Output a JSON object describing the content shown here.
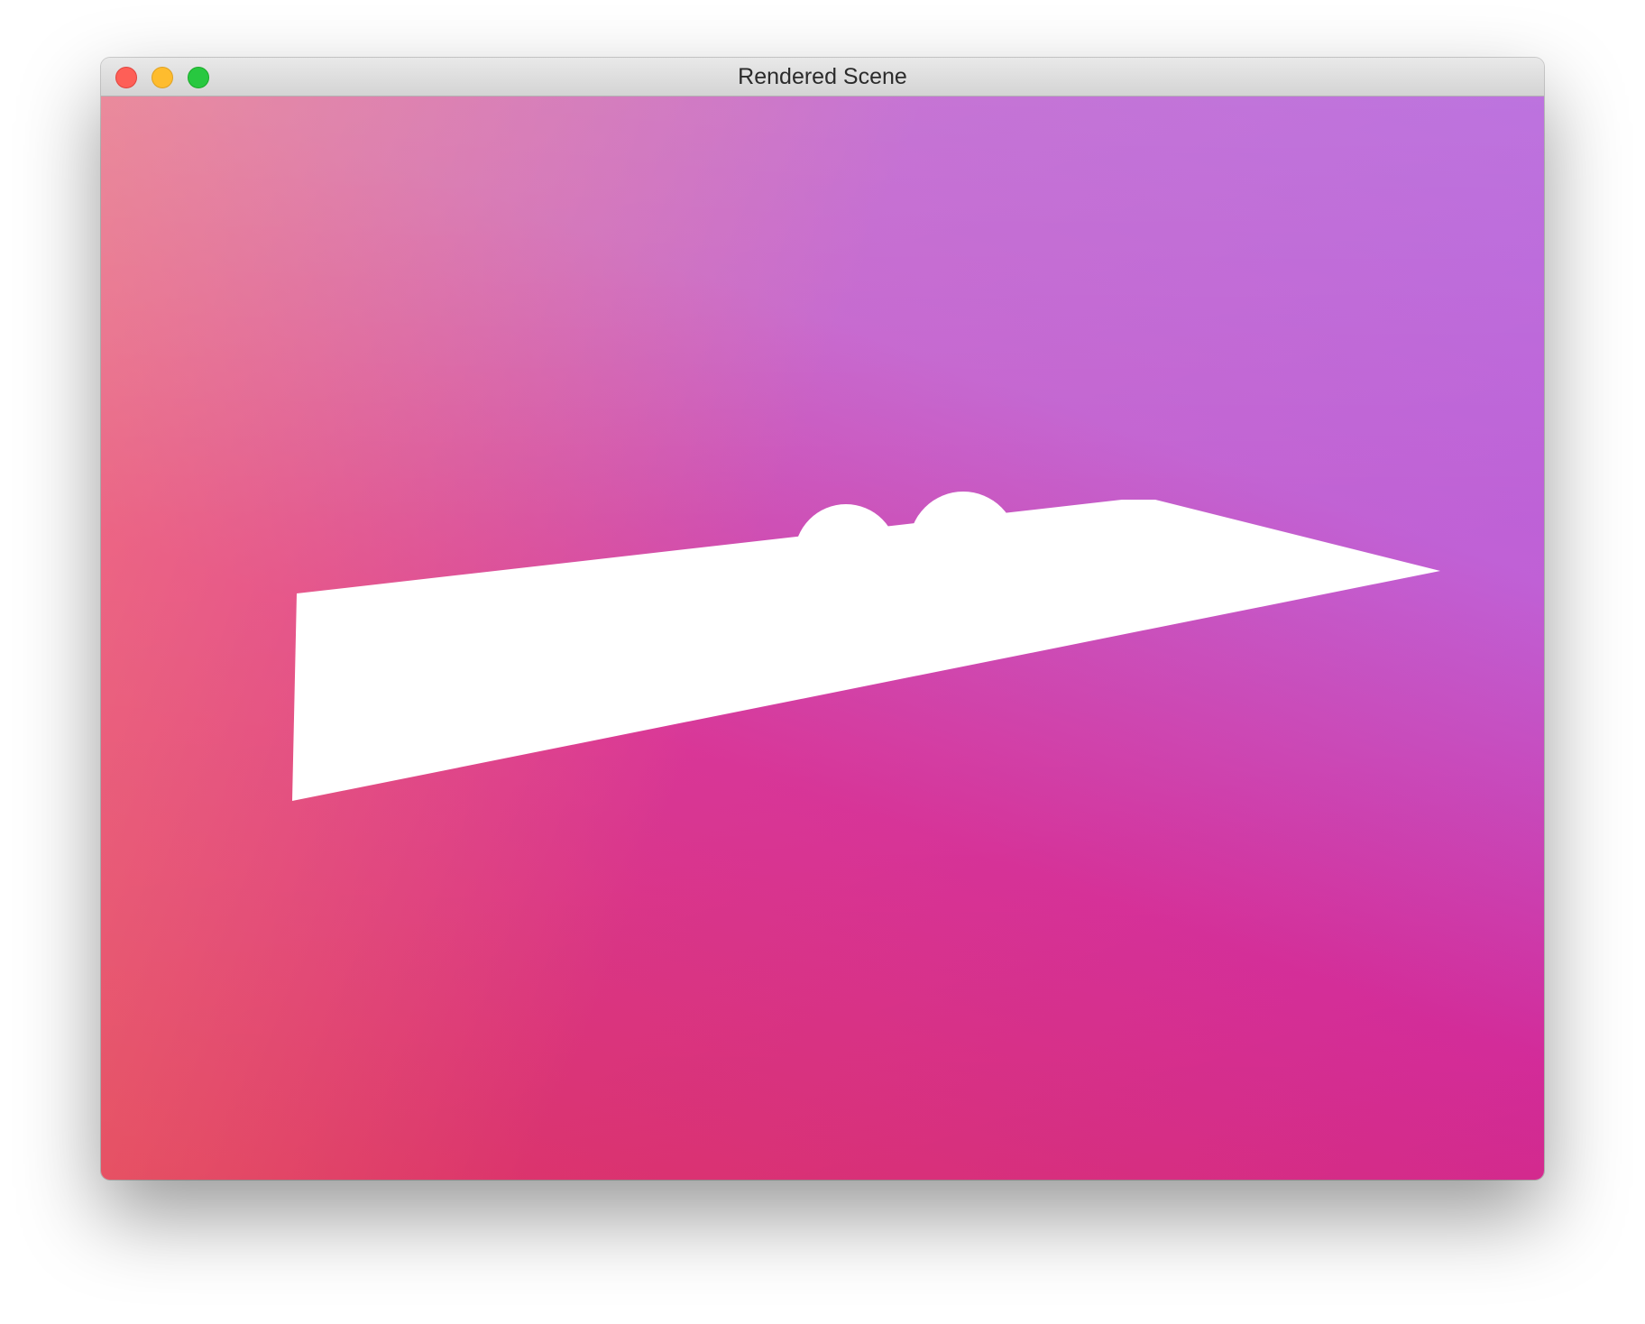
{
  "window": {
    "title": "Rendered Scene",
    "controls": {
      "close": "close-button",
      "minimize": "minimize-button",
      "zoom": "zoom-button"
    }
  },
  "viewport": {
    "background_colors": {
      "top_left": "#fd9375",
      "top_right": "#b98aee",
      "bottom_left": "#df2f64",
      "bottom_right": "#a02fe0"
    },
    "object_color": "#ffffff"
  }
}
